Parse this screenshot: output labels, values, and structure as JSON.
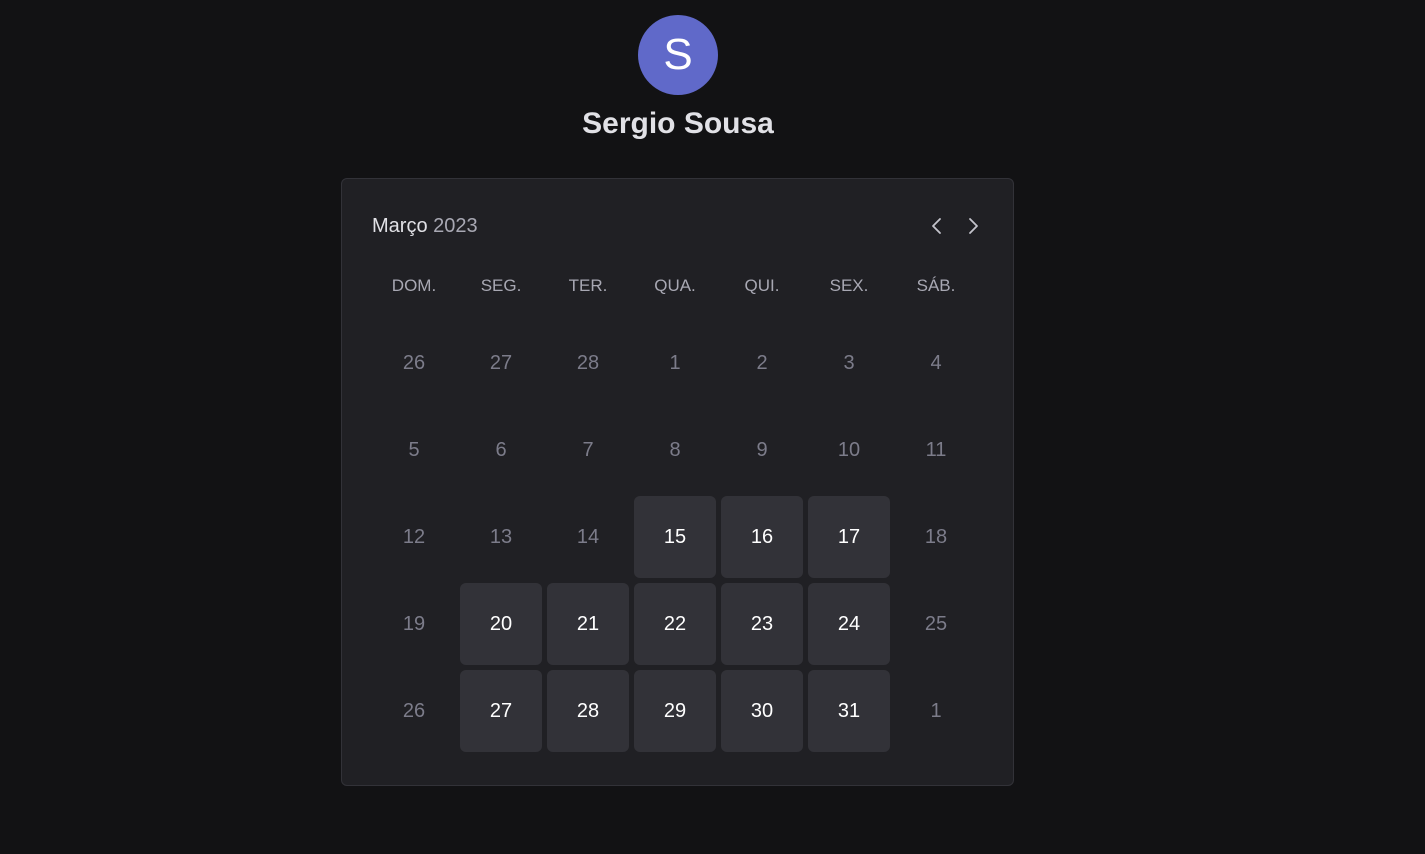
{
  "user": {
    "avatar_initial": "S",
    "name": "Sergio Sousa",
    "avatar_color": "#6069c9"
  },
  "calendar": {
    "month": "Março",
    "year": "2023",
    "prev_icon": "chevron-left-icon",
    "next_icon": "chevron-right-icon",
    "weekdays": [
      "DOM.",
      "SEG.",
      "TER.",
      "QUA.",
      "QUI.",
      "SEX.",
      "SÁB."
    ],
    "weeks": [
      [
        {
          "label": "26",
          "available": false
        },
        {
          "label": "27",
          "available": false
        },
        {
          "label": "28",
          "available": false
        },
        {
          "label": "1",
          "available": false
        },
        {
          "label": "2",
          "available": false
        },
        {
          "label": "3",
          "available": false
        },
        {
          "label": "4",
          "available": false
        }
      ],
      [
        {
          "label": "5",
          "available": false
        },
        {
          "label": "6",
          "available": false
        },
        {
          "label": "7",
          "available": false
        },
        {
          "label": "8",
          "available": false
        },
        {
          "label": "9",
          "available": false
        },
        {
          "label": "10",
          "available": false
        },
        {
          "label": "11",
          "available": false
        }
      ],
      [
        {
          "label": "12",
          "available": false
        },
        {
          "label": "13",
          "available": false
        },
        {
          "label": "14",
          "available": false
        },
        {
          "label": "15",
          "available": true
        },
        {
          "label": "16",
          "available": true
        },
        {
          "label": "17",
          "available": true
        },
        {
          "label": "18",
          "available": false
        }
      ],
      [
        {
          "label": "19",
          "available": false
        },
        {
          "label": "20",
          "available": true
        },
        {
          "label": "21",
          "available": true
        },
        {
          "label": "22",
          "available": true
        },
        {
          "label": "23",
          "available": true
        },
        {
          "label": "24",
          "available": true
        },
        {
          "label": "25",
          "available": false
        }
      ],
      [
        {
          "label": "26",
          "available": false
        },
        {
          "label": "27",
          "available": true
        },
        {
          "label": "28",
          "available": true
        },
        {
          "label": "29",
          "available": true
        },
        {
          "label": "30",
          "available": true
        },
        {
          "label": "31",
          "available": true
        },
        {
          "label": "1",
          "available": false
        }
      ]
    ]
  }
}
